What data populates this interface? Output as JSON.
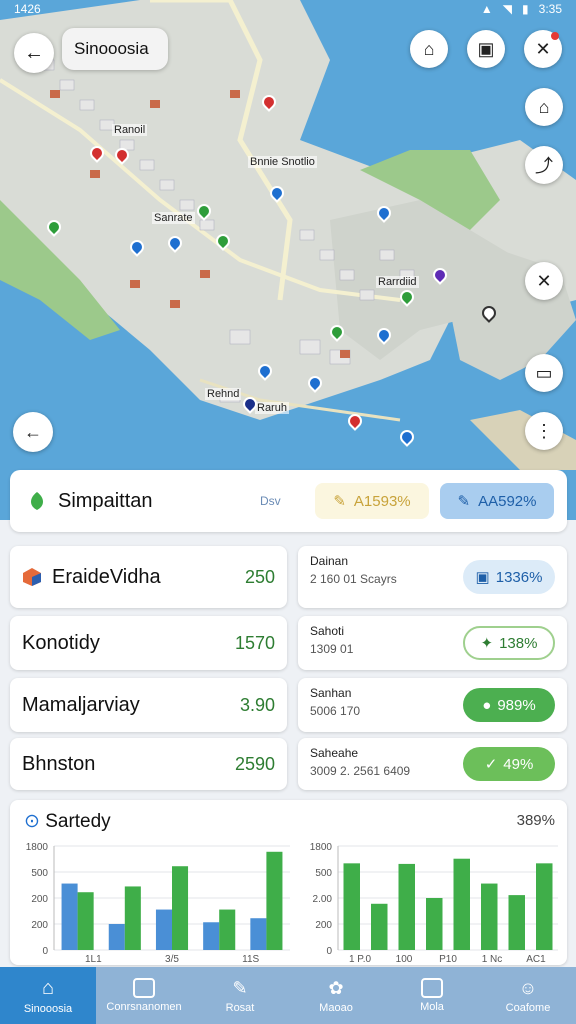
{
  "status": {
    "time": "1426",
    "time_right": "3:35"
  },
  "map": {
    "search_text": "Sinooosia",
    "labels": [
      "Ranoil",
      "Bnnie Snotlio",
      "Sanrate",
      "Rarrdiid",
      "Rehnd",
      "Raruh"
    ]
  },
  "top_card": {
    "title": "Simpaittan",
    "dropdown": "Dsv",
    "chip1": "A1593%",
    "chip2": "AA592%"
  },
  "left_rows": [
    {
      "name": "EraideVidha",
      "value": "250"
    },
    {
      "name": "Konotidy",
      "value": "1570"
    },
    {
      "name": "Mamaljarviay",
      "value": "3.90"
    },
    {
      "name": "Bhnston",
      "value": "2590"
    }
  ],
  "right_rows": [
    {
      "title": "Dainan",
      "sub": "2 160 01 Scayrs",
      "badge": "1336%"
    },
    {
      "title": "Sahoti",
      "sub": "1309 01",
      "badge": "138%"
    },
    {
      "title": "Sanhan",
      "sub": "5006 170",
      "badge": "989%"
    },
    {
      "title": "Saheahe",
      "sub": "3009 2. 2561 6409",
      "badge": "49%"
    }
  ],
  "chart": {
    "title": "Sartedy",
    "percent": "389%"
  },
  "chart_data": [
    {
      "type": "bar",
      "y_ticks": [
        "1800",
        "500",
        "200",
        "200",
        "0"
      ],
      "ylim": [
        0,
        1800
      ],
      "x_ticks": [
        "1L1",
        "3/5",
        "11S"
      ],
      "series": [
        {
          "color": "#4a8fd6",
          "values": [
            1150,
            450,
            700,
            480,
            550
          ]
        },
        {
          "color": "#3fae49",
          "values": [
            1000,
            1100,
            1450,
            700,
            1700
          ]
        }
      ]
    },
    {
      "type": "bar",
      "y_ticks": [
        "1800",
        "500",
        "2.00",
        "200",
        "0"
      ],
      "ylim": [
        0,
        1800
      ],
      "x_ticks": [
        "1 P.0",
        "100",
        "P10",
        "1 Nc",
        "AC1"
      ],
      "series": [
        {
          "color": "#3fae49",
          "values": [
            1500,
            800,
            1490,
            900,
            1580,
            1150,
            950,
            1500
          ]
        }
      ]
    }
  ],
  "nav": [
    "Sinooosia",
    "Conrsnanomen",
    "Rosat",
    "Maoao",
    "Mola",
    "Coafome"
  ],
  "colors": {
    "accent": "#2f86cc",
    "green": "#3fae49",
    "blue": "#4a8fd6"
  }
}
